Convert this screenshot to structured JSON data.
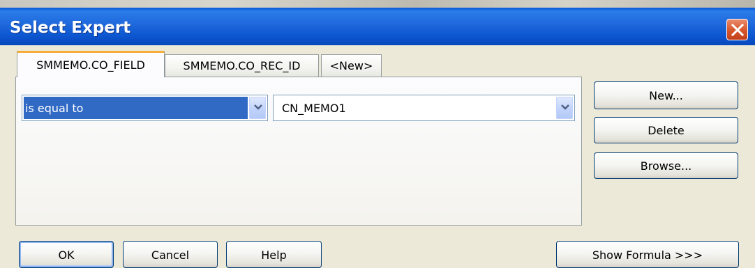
{
  "window": {
    "title": "Select Expert"
  },
  "tabs": [
    {
      "label": "SMMEMO.CO_FIELD",
      "active": true
    },
    {
      "label": "SMMEMO.CO_REC_ID",
      "active": false
    },
    {
      "label": "<New>",
      "active": false
    }
  ],
  "criteria": {
    "operator": {
      "value": "is equal to",
      "selected": true
    },
    "value": {
      "value": "CN_MEMO1"
    }
  },
  "side_buttons": {
    "new_label": "New...",
    "delete_label": "Delete",
    "browse_label": "Browse..."
  },
  "footer_buttons": {
    "ok_label": "OK",
    "cancel_label": "Cancel",
    "help_label": "Help",
    "show_formula_label": "Show Formula >>>"
  },
  "icons": {
    "close": "close-icon",
    "dropdown": "chevron-down-icon"
  },
  "colors": {
    "titlebar": "#0a5bd6",
    "selection": "#316ac5",
    "active_tab_accent": "#f6ad3c",
    "close_button": "#d9592f"
  }
}
